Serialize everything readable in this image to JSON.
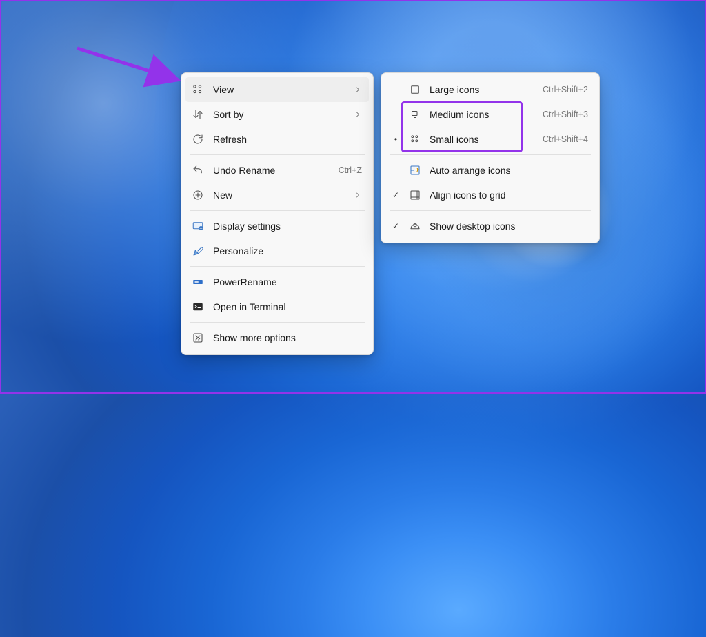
{
  "annotation": {
    "arrow_color": "#9333ea",
    "highlight_color": "#9333ea"
  },
  "main_menu": {
    "items": [
      {
        "label": "View",
        "shortcut": "",
        "has_submenu": true,
        "hover": true
      },
      {
        "label": "Sort by",
        "shortcut": "",
        "has_submenu": true,
        "hover": false
      },
      {
        "label": "Refresh",
        "shortcut": "",
        "has_submenu": false,
        "hover": false
      },
      {
        "label": "Undo Rename",
        "shortcut": "Ctrl+Z",
        "has_submenu": false,
        "hover": false
      },
      {
        "label": "New",
        "shortcut": "",
        "has_submenu": true,
        "hover": false
      },
      {
        "label": "Display settings",
        "shortcut": "",
        "has_submenu": false,
        "hover": false
      },
      {
        "label": "Personalize",
        "shortcut": "",
        "has_submenu": false,
        "hover": false
      },
      {
        "label": "PowerRename",
        "shortcut": "",
        "has_submenu": false,
        "hover": false
      },
      {
        "label": "Open in Terminal",
        "shortcut": "",
        "has_submenu": false,
        "hover": false
      },
      {
        "label": "Show more options",
        "shortcut": "",
        "has_submenu": false,
        "hover": false
      }
    ]
  },
  "view_submenu": {
    "items": [
      {
        "label": "Large icons",
        "shortcut": "Ctrl+Shift+2",
        "check": ""
      },
      {
        "label": "Medium icons",
        "shortcut": "Ctrl+Shift+3",
        "check": ""
      },
      {
        "label": "Small icons",
        "shortcut": "Ctrl+Shift+4",
        "check": "•"
      },
      {
        "label": "Auto arrange icons",
        "shortcut": "",
        "check": ""
      },
      {
        "label": "Align icons to grid",
        "shortcut": "",
        "check": "✓"
      },
      {
        "label": "Show desktop icons",
        "shortcut": "",
        "check": "✓"
      }
    ]
  }
}
